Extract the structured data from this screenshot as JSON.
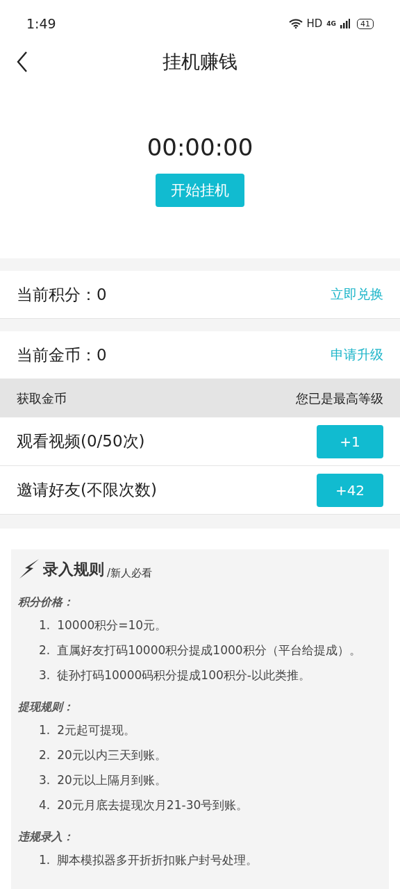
{
  "status_bar": {
    "time": "1:49",
    "hd": "HD",
    "network": "4G",
    "battery": "41"
  },
  "header": {
    "title": "挂机赚钱"
  },
  "timer": {
    "time": "00:00:00",
    "button": "开始挂机"
  },
  "points": {
    "label": "当前积分：0",
    "action": "立即兑换"
  },
  "coins": {
    "label": "当前金币：0",
    "action": "申请升级"
  },
  "earn_header": {
    "title": "获取金币",
    "status": "您已是最高等级"
  },
  "tasks": [
    {
      "label": "观看视频(0/50次)",
      "button": "+1"
    },
    {
      "label": "邀请好友(不限次数)",
      "button": "+42"
    }
  ],
  "rules": {
    "title": "录入规则",
    "subtitle": "/新人必看",
    "sections": [
      {
        "heading": "积分价格：",
        "items": [
          {
            "number": "1.",
            "text": "10000积分=10元。"
          },
          {
            "number": "2.",
            "text": "直属好友打码10000积分提成1000积分（平台给提成）。"
          },
          {
            "number": "3.",
            "text": "徒孙打码10000码积分提成100积分-以此类推。"
          }
        ]
      },
      {
        "heading": "提现规则：",
        "items": [
          {
            "number": "1.",
            "text": "2元起可提现。"
          },
          {
            "number": "2.",
            "text": "20元以内三天到账。"
          },
          {
            "number": "3.",
            "text": "20元以上隔月到账。"
          },
          {
            "number": "4.",
            "text": "20元月底去提现次月21-30号到账。"
          }
        ]
      },
      {
        "heading": "违规录入：",
        "items": [
          {
            "number": "1.",
            "text": "脚本模拟器多开折折扣账户封号处理。"
          }
        ]
      }
    ]
  }
}
